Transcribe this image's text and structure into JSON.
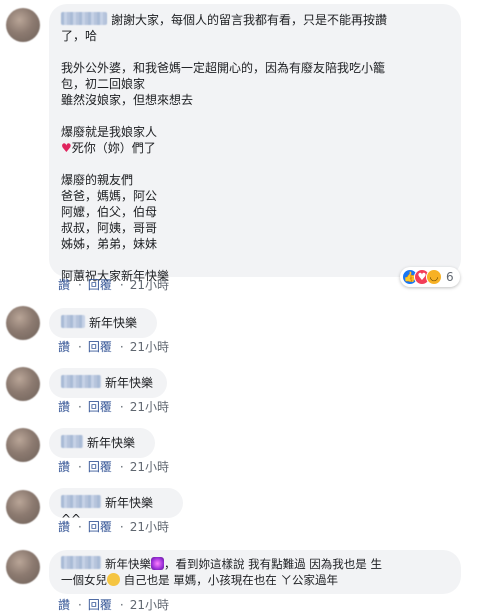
{
  "comments": [
    {
      "lines": [
        "謝謝大家，每個人的留言我都有看，只是不能再按讚",
        "了，哈",
        "",
        "我外公外婆，和我爸媽一定超開心的，因為有廢友陪我吃小籠",
        "包，初二回娘家",
        "雖然沒娘家，但想來想去",
        "",
        "爆廢就是我娘家人",
        "死你（妳）們了",
        "",
        "爆廢的親友們",
        "爸爸，媽媽，阿公",
        "阿嬤，伯父，伯母",
        "叔叔，阿姨，哥哥",
        "姊姊，弟弟，妹妹",
        "",
        "阿蕙祝大家新年快樂"
      ],
      "reaction_count": "6",
      "reaction_icons": [
        "like-icon",
        "love-icon",
        "haha-icon"
      ]
    },
    {
      "text": "新年快樂"
    },
    {
      "text": "新年快樂"
    },
    {
      "text": "新年快樂"
    },
    {
      "text": "新年快樂^^"
    },
    {
      "line1a": "新年快樂",
      "line1b": "，看到妳這樣說 我有點難過 因為我也是 生",
      "line2a": "一個女兒",
      "line2b": " 自己也是 單媽，小孩現在也在 ㄚ公家過年"
    }
  ],
  "actions": {
    "like": "讚",
    "reply": "回覆",
    "dot": "·",
    "time": "21小時"
  },
  "colors": {
    "bubble": "#f2f3f5",
    "link": "#385898",
    "meta": "#606770",
    "heart": "#e0245e"
  }
}
